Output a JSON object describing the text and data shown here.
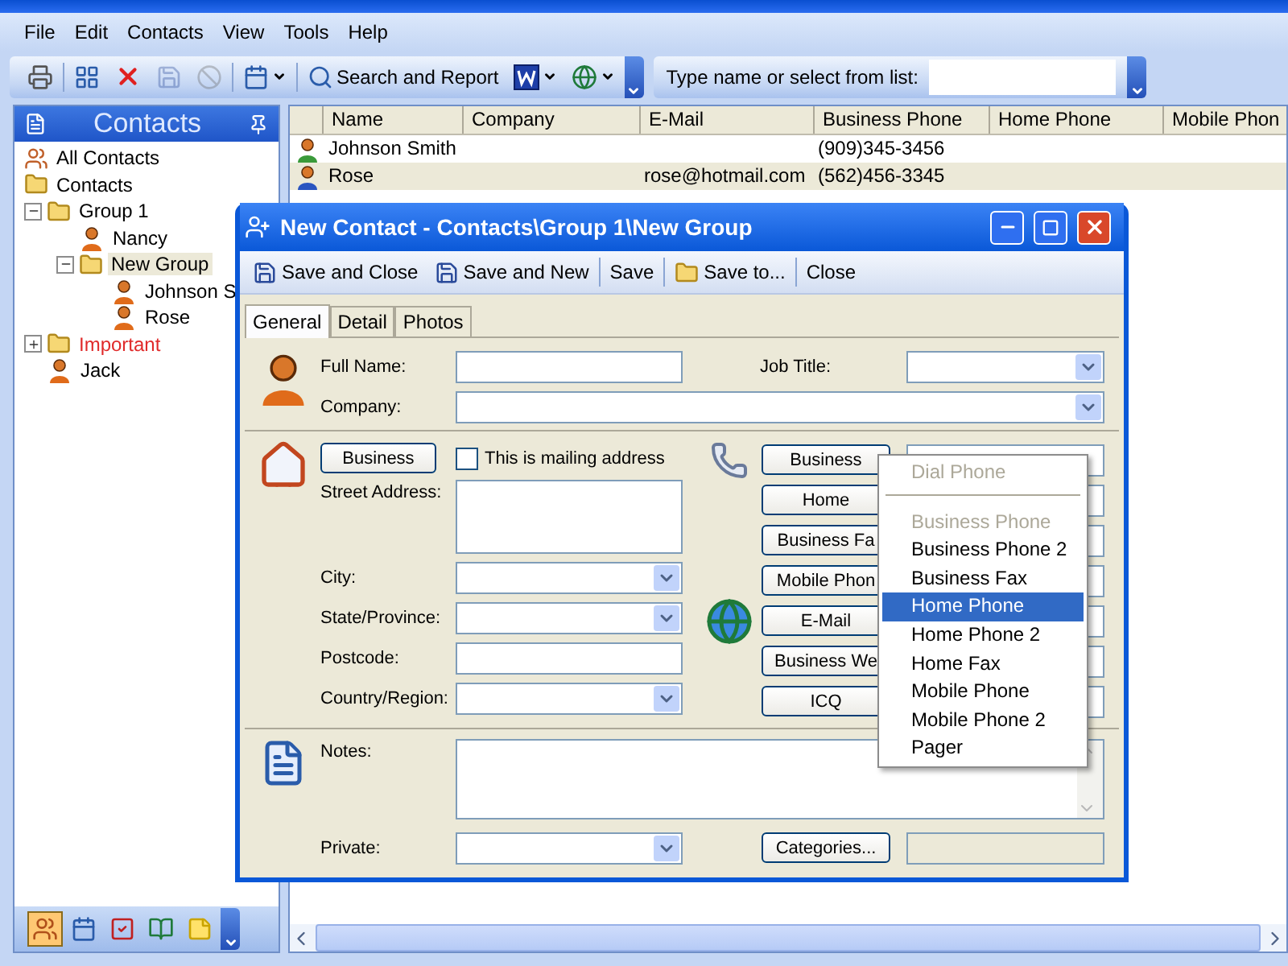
{
  "menu": [
    "File",
    "Edit",
    "Contacts",
    "View",
    "Tools",
    "Help"
  ],
  "toolbar": {
    "buttons": [
      {
        "kind": "print",
        "disabled": false,
        "dropdown": false
      },
      {
        "kind": "new",
        "disabled": false,
        "dropdown": false
      },
      {
        "kind": "delete",
        "disabled": false,
        "dropdown": false
      },
      {
        "kind": "save",
        "disabled": true,
        "dropdown": false
      },
      {
        "kind": "stop",
        "disabled": true,
        "dropdown": false
      },
      {
        "kind": "view",
        "disabled": false,
        "dropdown": true
      },
      {
        "kind": "search",
        "label": "Search and Report",
        "disabled": false,
        "dropdown": false
      },
      {
        "kind": "word",
        "disabled": false,
        "dropdown": true
      },
      {
        "kind": "web",
        "disabled": false,
        "dropdown": true
      }
    ],
    "quick_find": {
      "label": "Type name or select from list:"
    }
  },
  "sidebar": {
    "title": "Contacts",
    "tree": [
      {
        "label": "All Contacts",
        "kind": "all",
        "selected": false
      },
      {
        "label": "Contacts",
        "kind": "root",
        "selected": false,
        "children": [
          {
            "label": "Group 1",
            "kind": "folder",
            "selected": false,
            "expanded": true,
            "children": [
              {
                "label": "Nancy",
                "kind": "contact",
                "selected": false
              },
              {
                "label": "New Group",
                "kind": "folder",
                "selected": true,
                "expanded": true,
                "children": [
                  {
                    "label": "Johnson S",
                    "kind": "contact",
                    "selected": false
                  },
                  {
                    "label": "Rose",
                    "kind": "contact",
                    "selected": false
                  }
                ]
              }
            ]
          },
          {
            "label": "Important",
            "kind": "folder",
            "selected": false,
            "expanded": false,
            "color": "#e02a2a"
          },
          {
            "label": "Jack",
            "kind": "contact",
            "selected": false
          }
        ]
      }
    ],
    "nav_buttons": [
      {
        "kind": "contacts",
        "selected": true
      },
      {
        "kind": "calendar",
        "selected": false
      },
      {
        "kind": "tasks",
        "selected": false
      },
      {
        "kind": "journal",
        "selected": false
      },
      {
        "kind": "notes",
        "selected": false
      }
    ]
  },
  "table": {
    "columns": [
      "Name",
      "Company",
      "E-Mail",
      "Business Phone",
      "Home Phone",
      "Mobile Phon"
    ],
    "rows": [
      {
        "name": "Johnson Smith",
        "business_phone": "(909)345-3456",
        "selected": false
      },
      {
        "name": "Rose",
        "email": "rose@hotmail.com",
        "business_phone": "(562)456-3345",
        "selected": true
      }
    ]
  },
  "dialog": {
    "title": "New Contact - Contacts\\Group 1\\New Group",
    "toolbar": [
      {
        "kind": "save",
        "label": "Save and Close"
      },
      {
        "kind": "save",
        "label": "Save and New"
      },
      {
        "kind": "plain",
        "label": "Save"
      },
      {
        "kind": "folder",
        "label": "Save to..."
      },
      {
        "kind": "plain",
        "label": "Close"
      }
    ],
    "tabs": [
      {
        "label": "General",
        "selected": true
      },
      {
        "label": "Detail",
        "selected": false
      },
      {
        "label": "Photos",
        "selected": false
      }
    ],
    "full_name": {
      "label": "Full Name:"
    },
    "company": {
      "label": "Company:"
    },
    "job_title": {
      "label": "Job Title:"
    },
    "address": {
      "type_button": "Business",
      "mailing": {
        "label": "This is mailing address",
        "checked": false
      },
      "fields": [
        {
          "label": "Street Address:",
          "kind": "textarea"
        },
        {
          "label": "City:",
          "kind": "select"
        },
        {
          "label": "State/Province:",
          "kind": "select"
        },
        {
          "label": "Postcode:",
          "kind": "text"
        },
        {
          "label": "Country/Region:",
          "kind": "select"
        }
      ]
    },
    "contact_buttons": [
      "Business",
      "Home",
      "Business Fa",
      "Mobile Phon",
      "E-Mail",
      "Business We",
      "ICQ"
    ],
    "notes": {
      "label": "Notes:"
    },
    "private": {
      "label": "Private:"
    },
    "categories_button": "Categories...",
    "popup_menu": [
      {
        "kind": "item",
        "label": "Dial Phone",
        "disabled": true,
        "selected": false
      },
      {
        "kind": "separator"
      },
      {
        "kind": "item",
        "label": "Business Phone",
        "disabled": true,
        "selected": false
      },
      {
        "kind": "item",
        "label": "Business Phone 2",
        "disabled": false,
        "selected": false
      },
      {
        "kind": "item",
        "label": "Business Fax",
        "disabled": false,
        "selected": false
      },
      {
        "kind": "item",
        "label": "Home Phone",
        "disabled": false,
        "selected": true
      },
      {
        "kind": "item",
        "label": "Home Phone 2",
        "disabled": false,
        "selected": false
      },
      {
        "kind": "item",
        "label": "Home Fax",
        "disabled": false,
        "selected": false
      },
      {
        "kind": "item",
        "label": "Mobile Phone",
        "disabled": false,
        "selected": false
      },
      {
        "kind": "item",
        "label": "Mobile Phone 2",
        "disabled": false,
        "selected": false
      },
      {
        "kind": "item",
        "label": "Pager",
        "disabled": false,
        "selected": false
      }
    ]
  }
}
